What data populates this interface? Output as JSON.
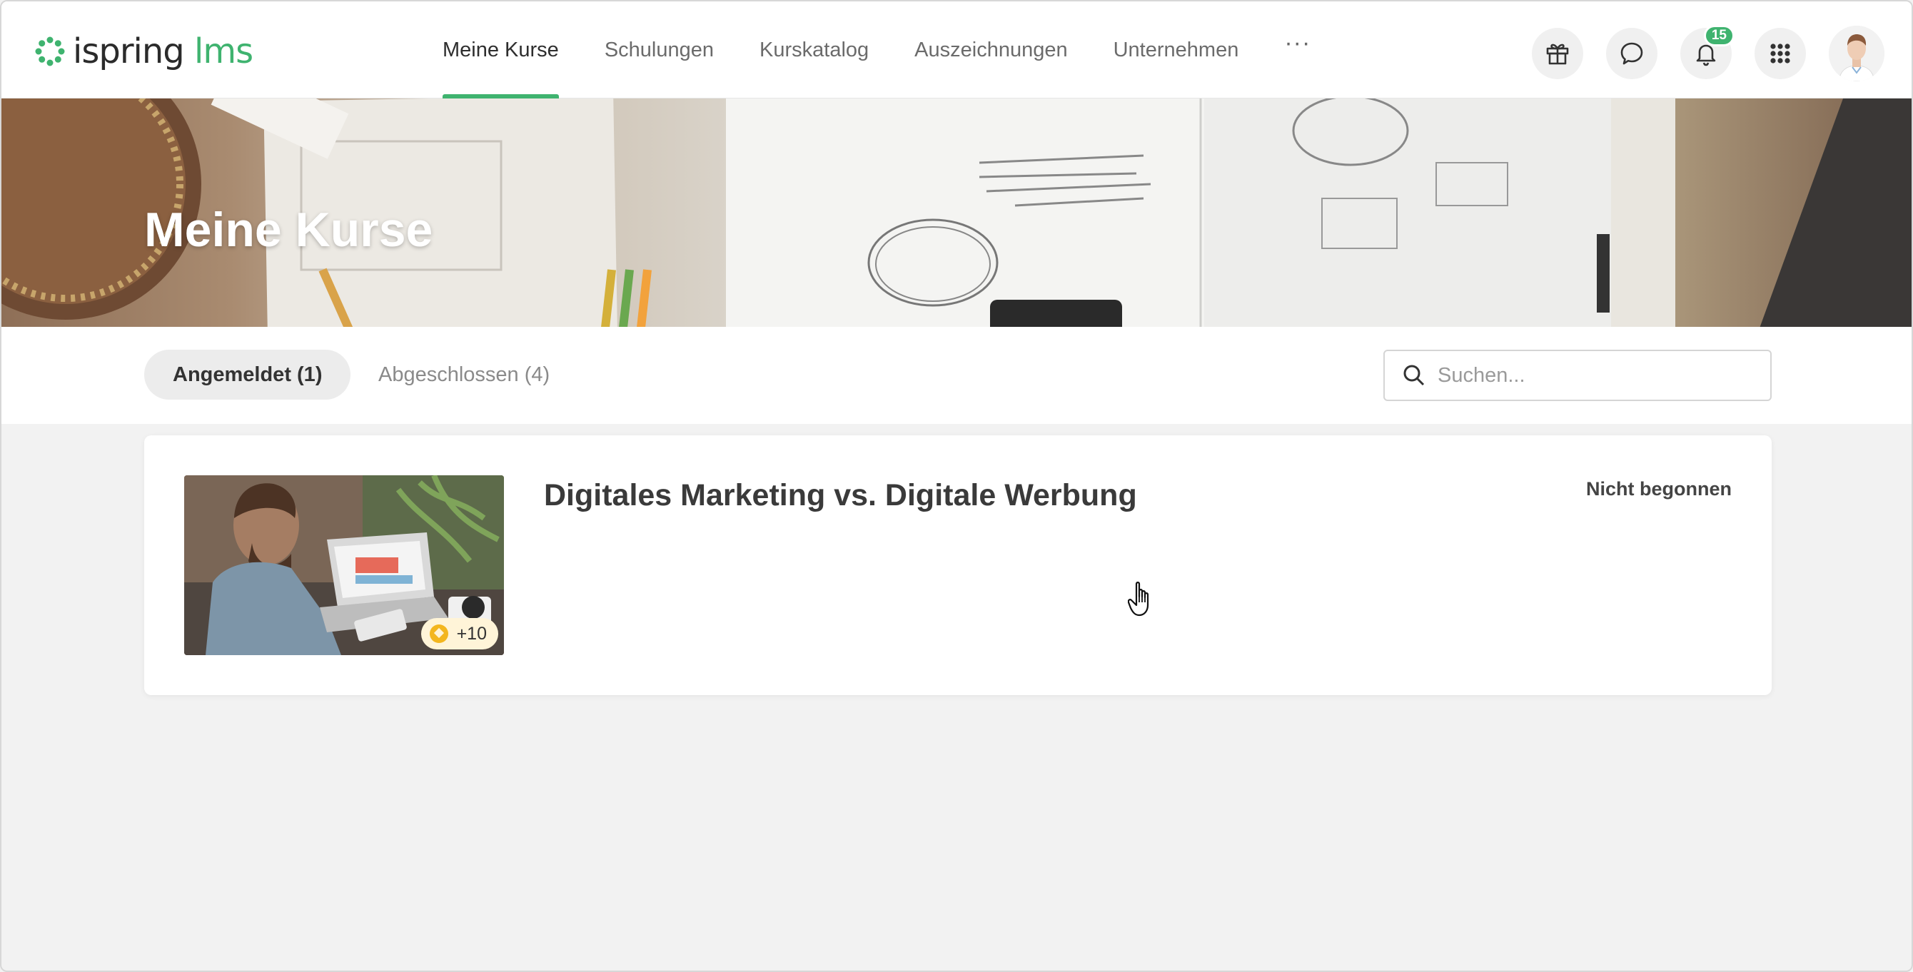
{
  "app": {
    "logo_main": "ispring",
    "logo_accent": "lms"
  },
  "nav": {
    "items": [
      {
        "label": "Meine Kurse",
        "active": true
      },
      {
        "label": "Schulungen",
        "active": false
      },
      {
        "label": "Kurskatalog",
        "active": false
      },
      {
        "label": "Auszeichnungen",
        "active": false
      },
      {
        "label": "Unternehmen",
        "active": false
      }
    ],
    "more_label": "···"
  },
  "header_icons": {
    "gift": "gift-icon",
    "chat": "chat-icon",
    "notifications": "bell-icon",
    "notifications_count": "15",
    "apps": "apps-grid-icon"
  },
  "banner": {
    "title": "Meine Kurse"
  },
  "tabs": [
    {
      "label": "Angemeldet (1)",
      "active": true
    },
    {
      "label": "Abgeschlossen (4)",
      "active": false
    }
  ],
  "search": {
    "placeholder": "Suchen...",
    "value": ""
  },
  "courses": [
    {
      "title": "Digitales Marketing vs. Digitale Werbung",
      "status": "Nicht begonnen",
      "points": "+10"
    }
  ],
  "colors": {
    "accent": "#3fb36f",
    "coin": "#f3b61f",
    "page_bg": "#f2f2f2"
  }
}
